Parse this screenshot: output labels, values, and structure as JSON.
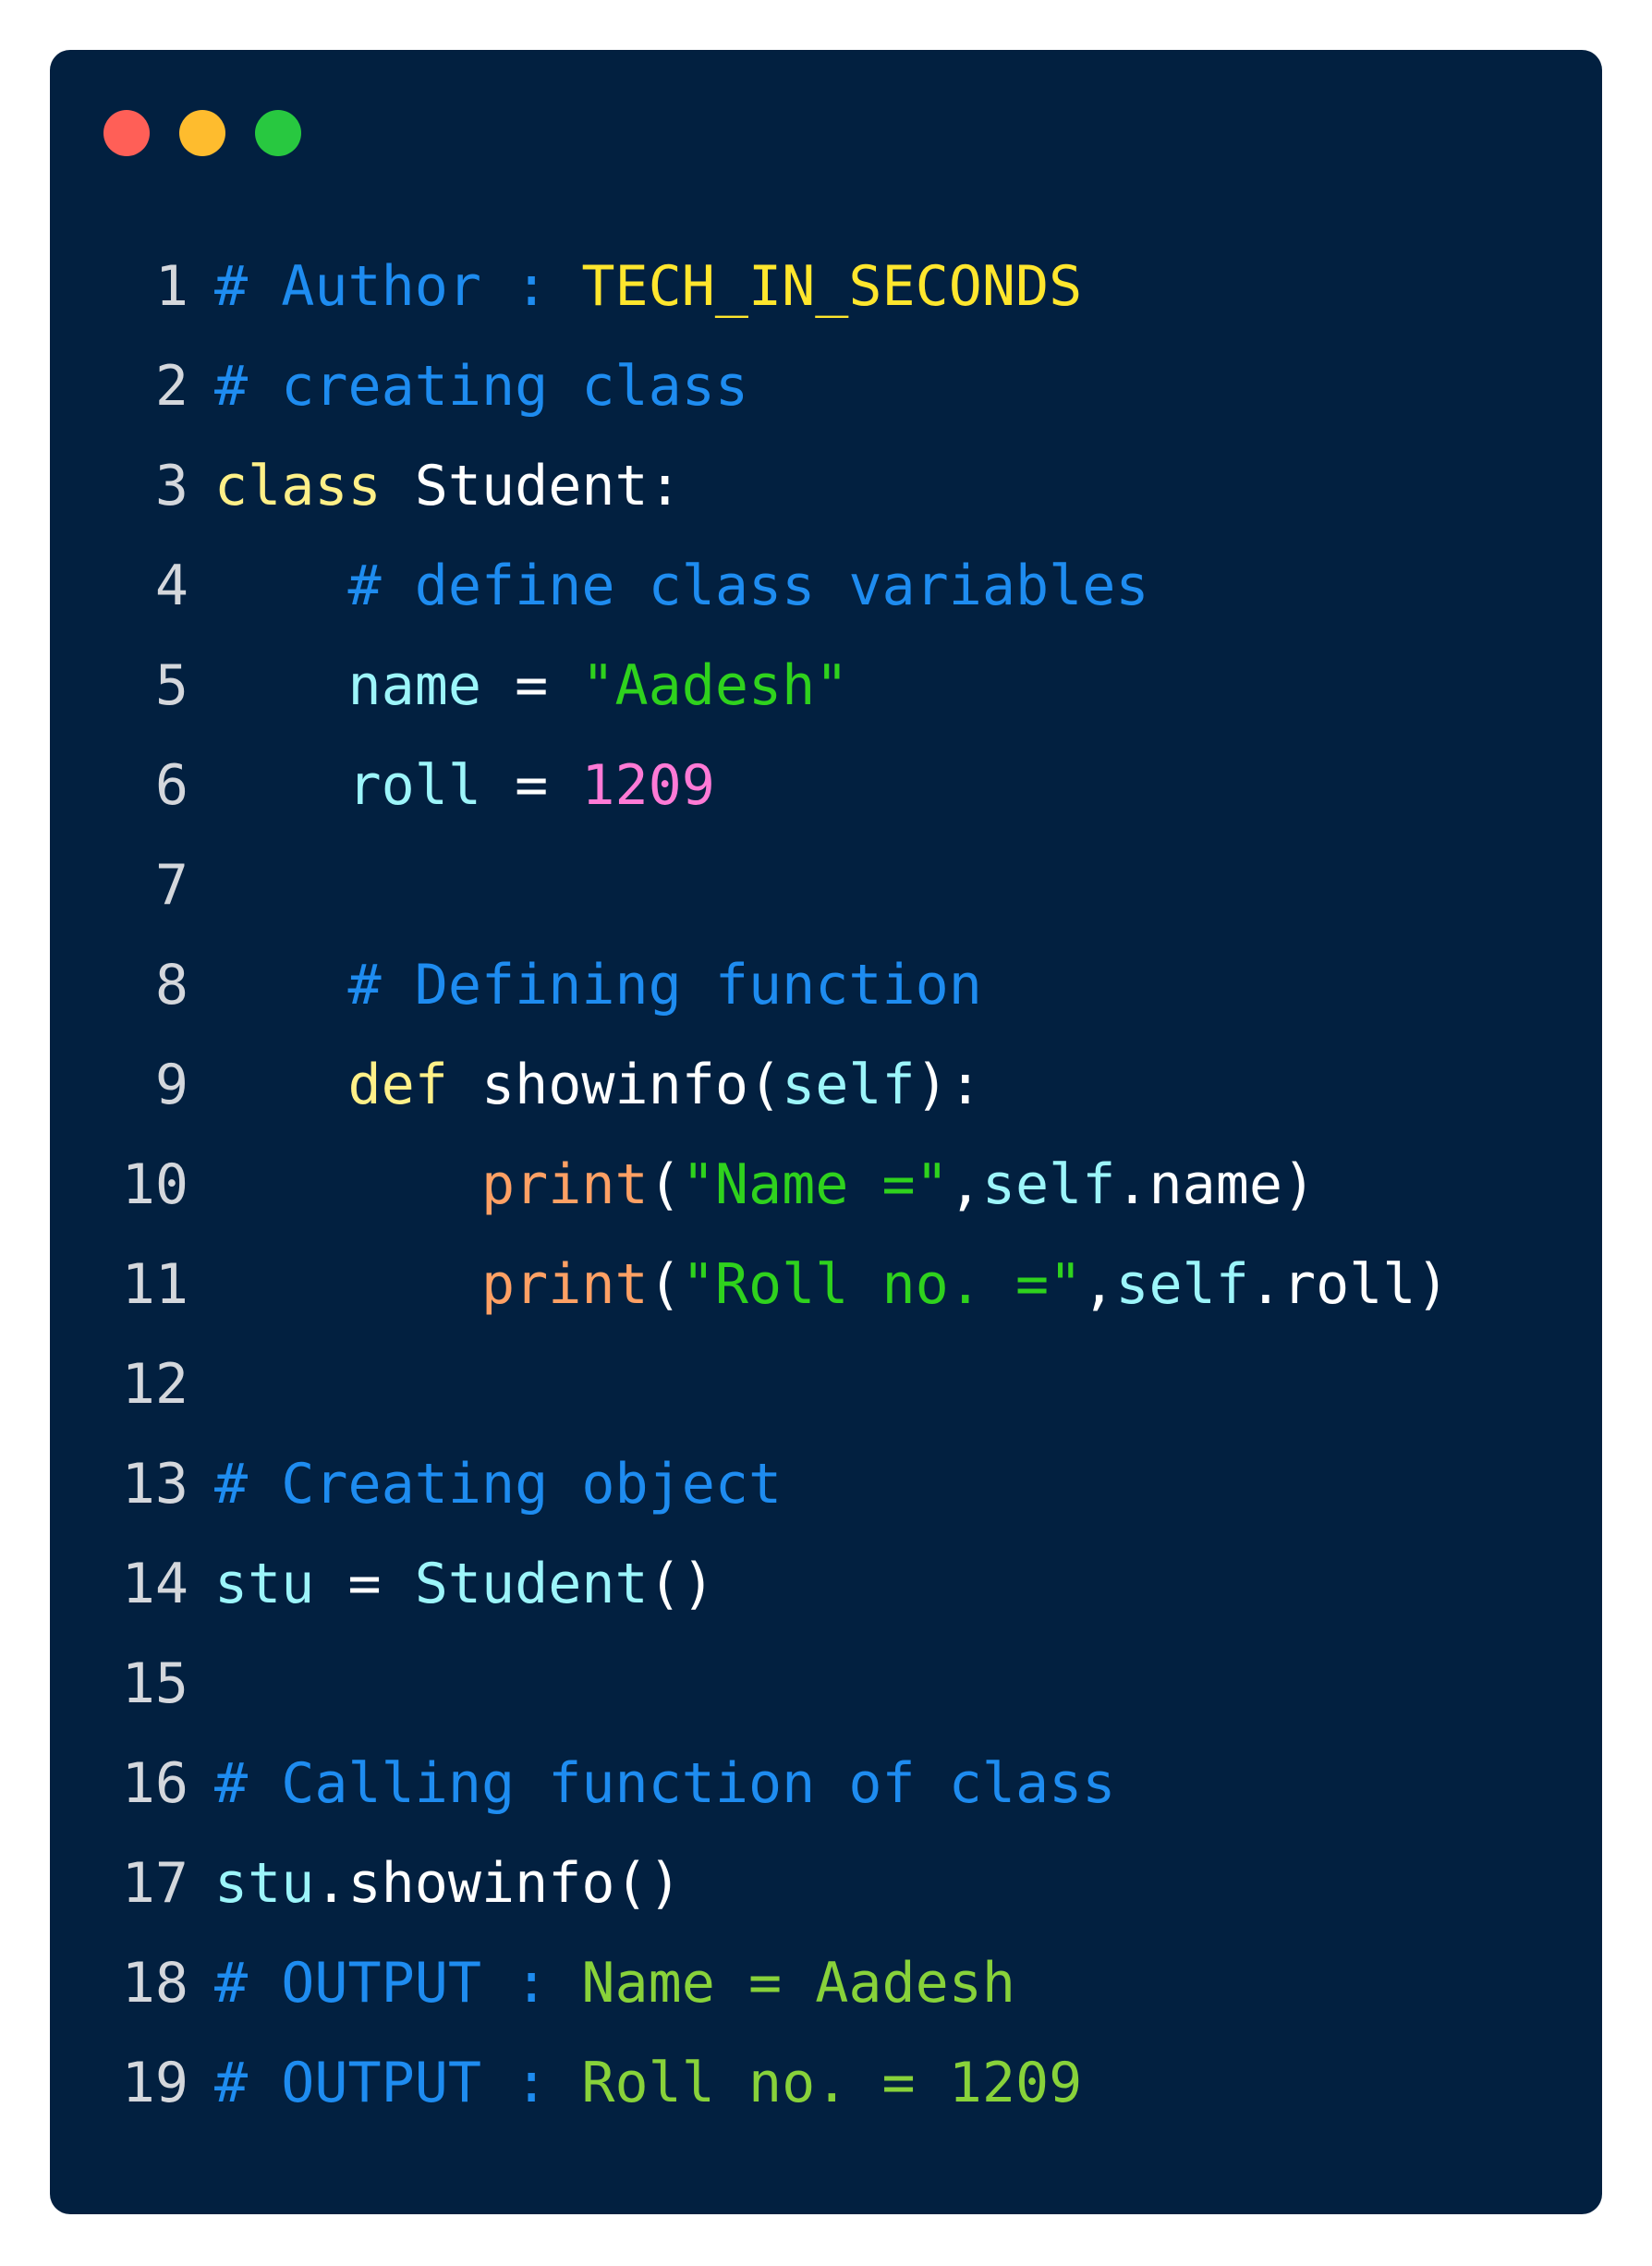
{
  "window": {
    "buttons": [
      {
        "name": "close-button",
        "color": "#ff5f57"
      },
      {
        "name": "minimize-button",
        "color": "#febc2e"
      },
      {
        "name": "zoom-button",
        "color": "#28c840"
      }
    ]
  },
  "colors": {
    "background": "#022040",
    "comment": "#1e8cf0",
    "keyword": "#fff088",
    "plain": "#ffffff",
    "variable": "#9cf5fa",
    "string": "#2fd21d",
    "number": "#ff7ad6",
    "builtin": "#ffa064",
    "author": "#ffe62d",
    "output": "#88d23a",
    "line_number": "#d4d7dc"
  },
  "code": {
    "lines": [
      {
        "n": "1",
        "tokens": [
          {
            "t": "# Author : ",
            "c": "comment"
          },
          {
            "t": "TECH_IN_SECONDS",
            "c": "author"
          }
        ]
      },
      {
        "n": "2",
        "tokens": [
          {
            "t": "# creating class",
            "c": "comment"
          }
        ]
      },
      {
        "n": "3",
        "tokens": [
          {
            "t": "class",
            "c": "keyword"
          },
          {
            "t": " Student:",
            "c": "plain"
          }
        ]
      },
      {
        "n": "4",
        "tokens": [
          {
            "t": "    # define class variables",
            "c": "comment"
          }
        ]
      },
      {
        "n": "5",
        "tokens": [
          {
            "t": "    ",
            "c": "plain"
          },
          {
            "t": "name",
            "c": "variable"
          },
          {
            "t": " = ",
            "c": "plain"
          },
          {
            "t": "\"Aadesh\"",
            "c": "string"
          }
        ]
      },
      {
        "n": "6",
        "tokens": [
          {
            "t": "    ",
            "c": "plain"
          },
          {
            "t": "roll",
            "c": "variable"
          },
          {
            "t": " = ",
            "c": "plain"
          },
          {
            "t": "1209",
            "c": "number"
          }
        ]
      },
      {
        "n": "7",
        "tokens": []
      },
      {
        "n": "8",
        "tokens": [
          {
            "t": "    # Defining function",
            "c": "comment"
          }
        ]
      },
      {
        "n": "9",
        "tokens": [
          {
            "t": "    ",
            "c": "plain"
          },
          {
            "t": "def",
            "c": "keyword"
          },
          {
            "t": " showinfo(",
            "c": "plain"
          },
          {
            "t": "self",
            "c": "variable"
          },
          {
            "t": "):",
            "c": "plain"
          }
        ]
      },
      {
        "n": "10",
        "tokens": [
          {
            "t": "        ",
            "c": "plain"
          },
          {
            "t": "print",
            "c": "builtin"
          },
          {
            "t": "(",
            "c": "plain"
          },
          {
            "t": "\"Name =\"",
            "c": "string"
          },
          {
            "t": ",",
            "c": "plain"
          },
          {
            "t": "self",
            "c": "variable"
          },
          {
            "t": ".name)",
            "c": "plain"
          }
        ]
      },
      {
        "n": "11",
        "tokens": [
          {
            "t": "        ",
            "c": "plain"
          },
          {
            "t": "print",
            "c": "builtin"
          },
          {
            "t": "(",
            "c": "plain"
          },
          {
            "t": "\"Roll no. =\"",
            "c": "string"
          },
          {
            "t": ",",
            "c": "plain"
          },
          {
            "t": "self",
            "c": "variable"
          },
          {
            "t": ".roll)",
            "c": "plain"
          }
        ]
      },
      {
        "n": "12",
        "tokens": []
      },
      {
        "n": "13",
        "tokens": [
          {
            "t": "# Creating object",
            "c": "comment"
          }
        ]
      },
      {
        "n": "14",
        "tokens": [
          {
            "t": "stu",
            "c": "variable"
          },
          {
            "t": " = ",
            "c": "plain"
          },
          {
            "t": "Student",
            "c": "variable"
          },
          {
            "t": "()",
            "c": "plain"
          }
        ]
      },
      {
        "n": "15",
        "tokens": []
      },
      {
        "n": "16",
        "tokens": [
          {
            "t": "# Calling function of class",
            "c": "comment"
          }
        ]
      },
      {
        "n": "17",
        "tokens": [
          {
            "t": "stu",
            "c": "variable"
          },
          {
            "t": ".showinfo()",
            "c": "plain"
          }
        ]
      },
      {
        "n": "18",
        "tokens": [
          {
            "t": "# OUTPUT : ",
            "c": "comment"
          },
          {
            "t": "Name = Aadesh",
            "c": "output"
          }
        ]
      },
      {
        "n": "19",
        "tokens": [
          {
            "t": "# OUTPUT : ",
            "c": "comment"
          },
          {
            "t": "Roll no. = 1209",
            "c": "output"
          }
        ]
      }
    ]
  }
}
